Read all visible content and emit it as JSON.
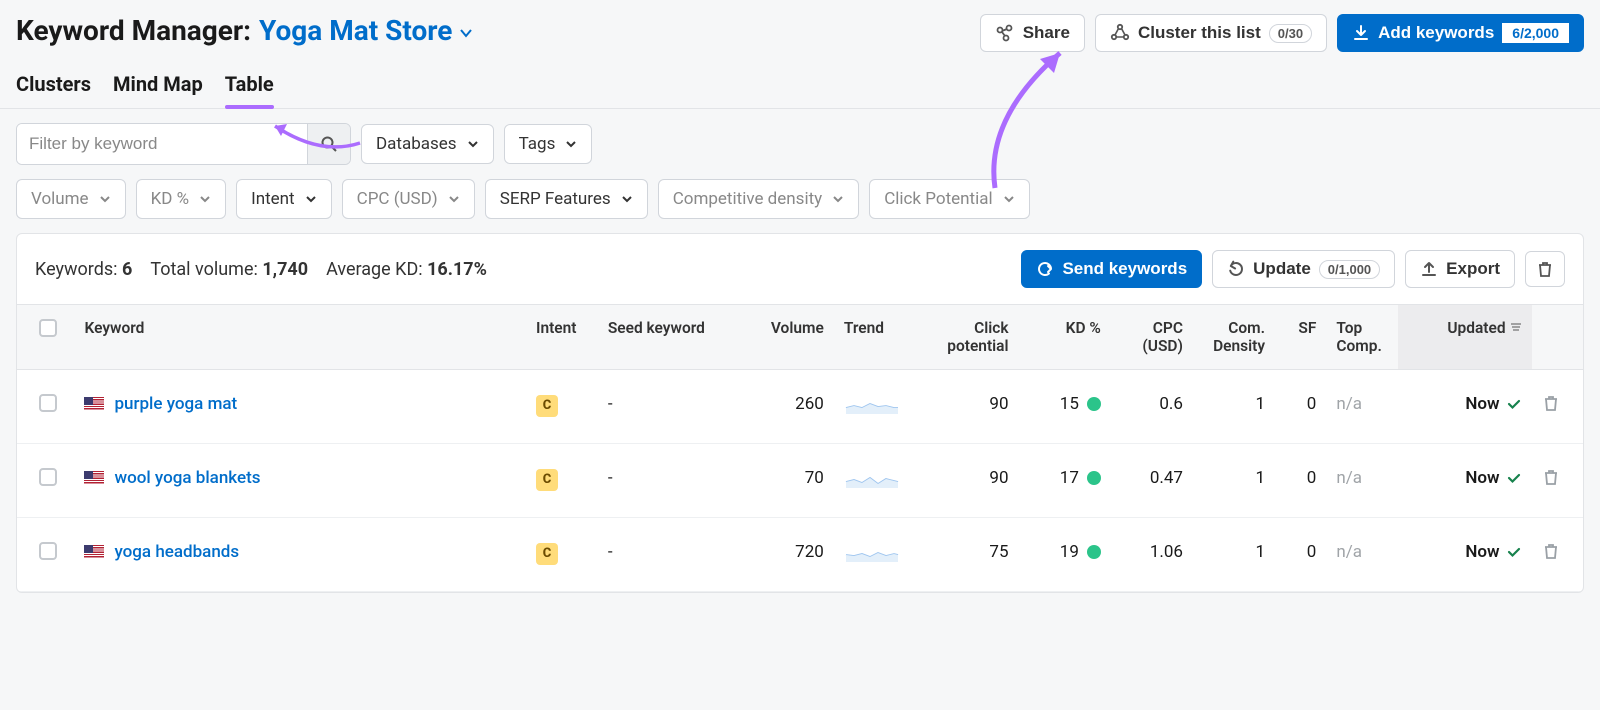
{
  "header": {
    "title_static": "Keyword Manager:",
    "store_name": "Yoga Mat Store",
    "share_label": "Share",
    "cluster_label": "Cluster this list",
    "cluster_count": "0/30",
    "add_label": "Add keywords",
    "add_count": "6/2,000"
  },
  "tabs": {
    "clusters": "Clusters",
    "mindmap": "Mind Map",
    "table": "Table"
  },
  "filters": {
    "input_placeholder": "Filter by keyword",
    "databases": "Databases",
    "tags": "Tags",
    "volume": "Volume",
    "kd": "KD %",
    "intent": "Intent",
    "cpc": "CPC (USD)",
    "serp": "SERP Features",
    "competitive": "Competitive density",
    "clickpot": "Click Potential"
  },
  "panel": {
    "keywords_label": "Keywords:",
    "keywords_value": "6",
    "totalvol_label": "Total volume:",
    "totalvol_value": "1,740",
    "avgkd_label": "Average KD:",
    "avgkd_value": "16.17%",
    "send_label": "Send keywords",
    "update_label": "Update",
    "update_count": "0/1,000",
    "export_label": "Export"
  },
  "columns": {
    "keyword": "Keyword",
    "intent": "Intent",
    "seed": "Seed keyword",
    "volume": "Volume",
    "trend": "Trend",
    "click": "Click potential",
    "kd": "KD %",
    "cpc": "CPC (USD)",
    "com": "Com. Density",
    "sf": "SF",
    "top": "Top Comp.",
    "updated": "Updated"
  },
  "rows": [
    {
      "keyword": "purple yoga mat",
      "intent": "C",
      "seed": "-",
      "volume": "260",
      "click": "90",
      "kd": "15",
      "cpc": "0.6",
      "com": "1",
      "sf": "0",
      "top": "n/a",
      "updated": "Now"
    },
    {
      "keyword": "wool yoga blankets",
      "intent": "C",
      "seed": "-",
      "volume": "70",
      "click": "90",
      "kd": "17",
      "cpc": "0.47",
      "com": "1",
      "sf": "0",
      "top": "n/a",
      "updated": "Now"
    },
    {
      "keyword": "yoga headbands",
      "intent": "C",
      "seed": "-",
      "volume": "720",
      "click": "75",
      "kd": "19",
      "cpc": "1.06",
      "com": "1",
      "sf": "0",
      "top": "n/a",
      "updated": "Now"
    }
  ]
}
